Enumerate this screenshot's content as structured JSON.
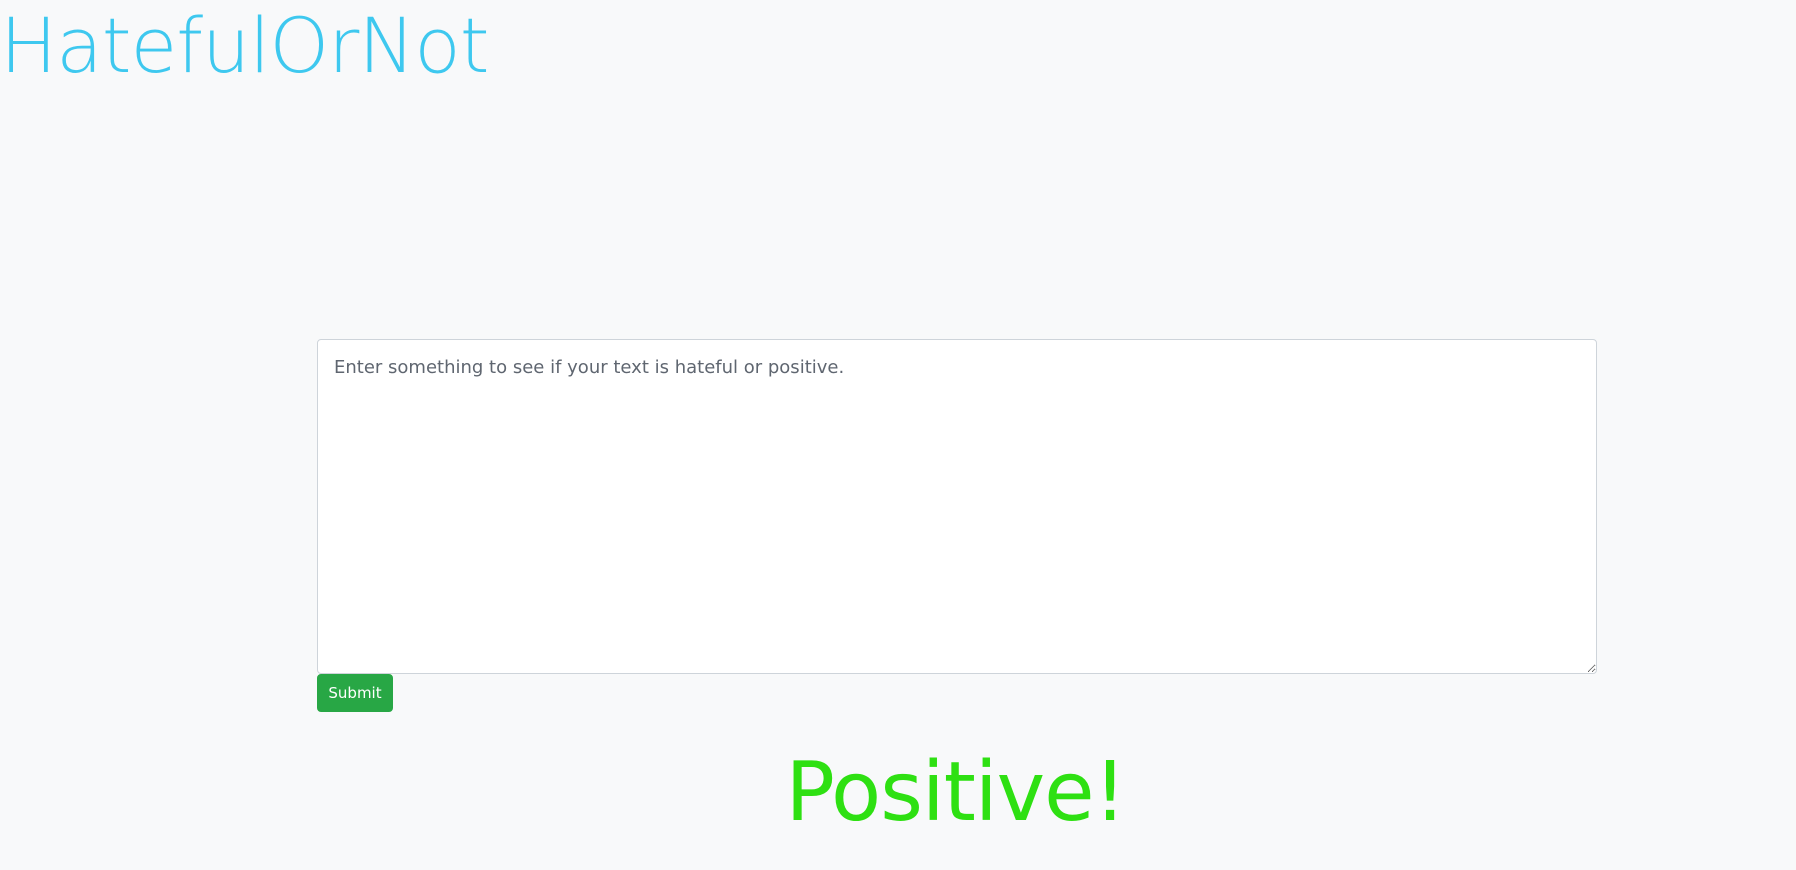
{
  "header": {
    "title": "HatefulOrNot",
    "title_color": "#3ec8ef"
  },
  "form": {
    "input_placeholder": "Enter something to see if your text is hateful or positive.",
    "input_value": "",
    "submit_label": "Submit",
    "submit_color": "#28a745"
  },
  "result": {
    "label": "Positive!",
    "color": "#2ee012"
  }
}
